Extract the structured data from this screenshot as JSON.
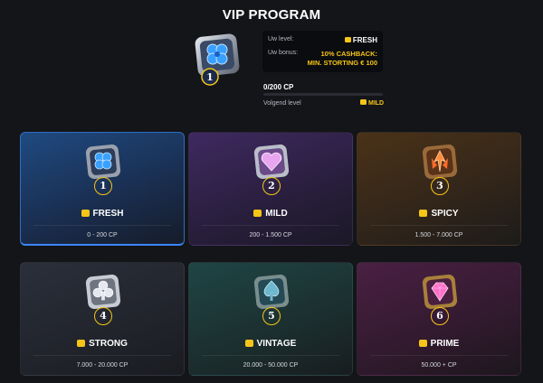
{
  "page": {
    "title": "VIP PROGRAM"
  },
  "status": {
    "current_level_label": "Uw level:",
    "current_level_value": "FRESH",
    "bonus_label": "Uw bonus:",
    "bonus_value_line1": "10% CASHBACK:",
    "bonus_value_line2": "MIN. STORTING € 100",
    "progress_text": "0/200 CP",
    "progress_fraction": 0,
    "next_level_label": "Volgend level",
    "next_level_value": "MILD"
  },
  "hero": {
    "level_number": "1"
  },
  "levels": [
    {
      "number": "1",
      "name": "FRESH",
      "range": "0 - 200 CP",
      "active": true,
      "gem": "clover-gem-icon"
    },
    {
      "number": "2",
      "name": "MILD",
      "range": "200 - 1.500 CP",
      "active": false,
      "gem": "heart-gem-icon"
    },
    {
      "number": "3",
      "name": "SPICY",
      "range": "1.500 - 7.000 CP",
      "active": false,
      "gem": "flame-gem-icon"
    },
    {
      "number": "4",
      "name": "STRONG",
      "range": "7.000 - 20.000 CP",
      "active": false,
      "gem": "club-gem-icon"
    },
    {
      "number": "5",
      "name": "VINTAGE",
      "range": "20.000 - 50.000 CP",
      "active": false,
      "gem": "spade-gem-icon"
    },
    {
      "number": "6",
      "name": "PRIME",
      "range": "50.000 + CP",
      "active": false,
      "gem": "diamond-gem-icon"
    }
  ],
  "colors": {
    "accent": "#f5c518",
    "active_border": "#3d86ff",
    "background": "#141519"
  }
}
